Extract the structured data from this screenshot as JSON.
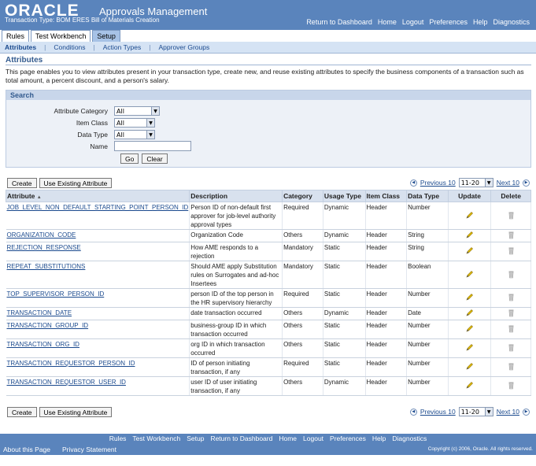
{
  "brand": {
    "logo": "ORACLE",
    "app_title": "Approvals Management",
    "subtitle": "Transaction Type: BOM ERES Bill of Materials Creation"
  },
  "global_links": [
    "Return to Dashboard",
    "Home",
    "Logout",
    "Preferences",
    "Help",
    "Diagnostics"
  ],
  "tabs": [
    "Rules",
    "Test Workbench",
    "Setup"
  ],
  "active_tab": "Setup",
  "subtabs": [
    "Attributes",
    "Conditions",
    "Action Types",
    "Approver Groups"
  ],
  "page_title": "Attributes",
  "description": "This page enables you to view attributes present in your transaction type, create new, and reuse existing attributes to specify the business components of a transaction such as total amount, a percent discount, and a person's salary.",
  "search": {
    "title": "Search",
    "fields": [
      {
        "label": "Attribute Category",
        "value": "All"
      },
      {
        "label": "Item Class",
        "value": "All"
      },
      {
        "label": "Data Type",
        "value": "All"
      },
      {
        "label": "Name",
        "value": ""
      }
    ],
    "go_label": "Go",
    "clear_label": "Clear"
  },
  "toolbar": {
    "create_label": "Create",
    "use_existing_label": "Use Existing Attribute"
  },
  "pager": {
    "previous_label": "Previous 10",
    "range": "11-20",
    "next_label": "Next 10"
  },
  "table": {
    "columns": [
      "Attribute",
      "Description",
      "Category",
      "Usage Type",
      "Item Class",
      "Data Type",
      "Update",
      "Delete"
    ],
    "rows": [
      {
        "attribute": "JOB_LEVEL_NON_DEFAULT_STARTING_POINT_PERSON_ID",
        "description": "Person ID of non-default first approver for job-level authority approval types",
        "category": "Required",
        "usage": "Dynamic",
        "item_class": "Header",
        "data_type": "Number"
      },
      {
        "attribute": "ORGANIZATION_CODE",
        "description": "Organization Code",
        "category": "Others",
        "usage": "Dynamic",
        "item_class": "Header",
        "data_type": "String"
      },
      {
        "attribute": "REJECTION_RESPONSE",
        "description": "How AME responds to a rejection",
        "category": "Mandatory",
        "usage": "Static",
        "item_class": "Header",
        "data_type": "String"
      },
      {
        "attribute": "REPEAT_SUBSTITUTIONS",
        "description": "Should AME apply Substitution rules on Surrogates and ad-hoc Insertees",
        "category": "Mandatory",
        "usage": "Static",
        "item_class": "Header",
        "data_type": "Boolean"
      },
      {
        "attribute": "TOP_SUPERVISOR_PERSON_ID",
        "description": "person ID of the top person in the HR supervisory hierarchy",
        "category": "Required",
        "usage": "Static",
        "item_class": "Header",
        "data_type": "Number"
      },
      {
        "attribute": "TRANSACTION_DATE",
        "description": "date transaction occurred",
        "category": "Others",
        "usage": "Dynamic",
        "item_class": "Header",
        "data_type": "Date"
      },
      {
        "attribute": "TRANSACTION_GROUP_ID",
        "description": "business-group ID in which transaction occurred",
        "category": "Others",
        "usage": "Static",
        "item_class": "Header",
        "data_type": "Number"
      },
      {
        "attribute": "TRANSACTION_ORG_ID",
        "description": "org ID in which transaction occurred",
        "category": "Others",
        "usage": "Static",
        "item_class": "Header",
        "data_type": "Number"
      },
      {
        "attribute": "TRANSACTION_REQUESTOR_PERSON_ID",
        "description": "ID of person initiating transaction, if any",
        "category": "Required",
        "usage": "Static",
        "item_class": "Header",
        "data_type": "Number"
      },
      {
        "attribute": "TRANSACTION_REQUESTOR_USER_ID",
        "description": "user ID of user initiating transaction, if any",
        "category": "Others",
        "usage": "Dynamic",
        "item_class": "Header",
        "data_type": "Number"
      }
    ]
  },
  "footer": {
    "links": [
      "Rules",
      "Test Workbench",
      "Setup",
      "Return to Dashboard",
      "Home",
      "Logout",
      "Preferences",
      "Help",
      "Diagnostics"
    ],
    "about": "About this Page",
    "privacy": "Privacy Statement",
    "copyright": "Copyright (c) 2006, Oracle. All rights reserved."
  },
  "icons": {
    "update": "pencil-icon",
    "delete": "trash-icon",
    "sort": "sort-ascending-icon"
  },
  "colors": {
    "header": "#5a84bc",
    "link": "#1b4a8e",
    "title": "#335b8f"
  }
}
